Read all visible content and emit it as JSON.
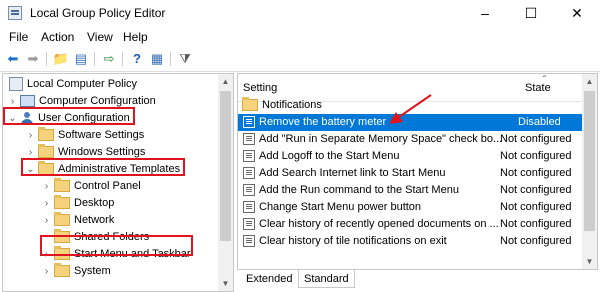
{
  "window": {
    "title": "Local Group Policy Editor",
    "controls": [
      "–",
      "☐",
      "✕"
    ]
  },
  "menu": [
    "File",
    "Action",
    "View",
    "Help"
  ],
  "toolbar": {
    "buttons": [
      "back-arrow-icon",
      "forward-arrow-icon",
      "up-folder-icon",
      "show-hide-tree-icon",
      "export-list-icon",
      "help-icon",
      "properties-icon",
      "filter-icon"
    ]
  },
  "tree": {
    "root": "Local Computer Policy",
    "computer_config": "Computer Configuration",
    "user_config": "User Configuration",
    "software_settings": "Software Settings",
    "windows_settings": "Windows Settings",
    "admin_templates": "Administrative Templates",
    "control_panel": "Control Panel",
    "desktop": "Desktop",
    "network": "Network",
    "shared_folders": "Shared Folders",
    "start_menu": "Start Menu and Taskbar",
    "system": "System"
  },
  "details": {
    "col_setting": "Setting",
    "col_state": "State",
    "rows": [
      {
        "setting": "Notifications",
        "state": ""
      },
      {
        "setting": "Remove the battery meter",
        "state": "Disabled"
      },
      {
        "setting": "Add \"Run in Separate Memory Space\" check bo...",
        "state": "Not configured"
      },
      {
        "setting": "Add Logoff to the Start Menu",
        "state": "Not configured"
      },
      {
        "setting": "Add Search Internet link to Start Menu",
        "state": "Not configured"
      },
      {
        "setting": "Add the Run command to the Start Menu",
        "state": "Not configured"
      },
      {
        "setting": "Change Start Menu power button",
        "state": "Not configured"
      },
      {
        "setting": "Clear history of recently opened documents on ...",
        "state": "Not configured"
      },
      {
        "setting": "Clear history of tile notifications on exit",
        "state": "Not configured"
      }
    ]
  },
  "tabs": {
    "extended": "Extended",
    "standard": "Standard"
  },
  "colors": {
    "selection": "#0078d7",
    "highlight_box": "#e0141e"
  }
}
